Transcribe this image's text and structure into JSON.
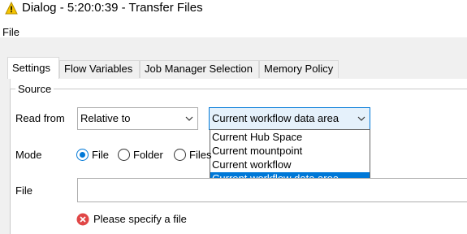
{
  "window": {
    "title": "Dialog - 5:20:0:39 - Transfer Files",
    "icon": "warning-triangle-icon"
  },
  "menu": {
    "file": "File"
  },
  "tabs": [
    {
      "label": "Settings",
      "active": true
    },
    {
      "label": "Flow Variables",
      "active": false
    },
    {
      "label": "Job Manager Selection",
      "active": false
    },
    {
      "label": "Memory Policy",
      "active": false
    }
  ],
  "source": {
    "legend": "Source",
    "read_from": {
      "label": "Read from",
      "mode_value": "Relative to",
      "location_value": "Current workflow data area",
      "options": [
        "Current Hub Space",
        "Current mountpoint",
        "Current workflow",
        "Current workflow data area"
      ],
      "selected_option": "Current workflow data area"
    },
    "mode": {
      "label": "Mode",
      "options": [
        "File",
        "Folder",
        "Files"
      ],
      "selected": "File"
    },
    "file": {
      "label": "File",
      "value": ""
    },
    "error": {
      "icon": "error-x-icon",
      "message": "Please specify a file"
    }
  },
  "colors": {
    "accent": "#0078d7",
    "dialog_bg": "#f0f0f0",
    "error_red": "#e04646",
    "warning_yellow": "#f5c400"
  }
}
